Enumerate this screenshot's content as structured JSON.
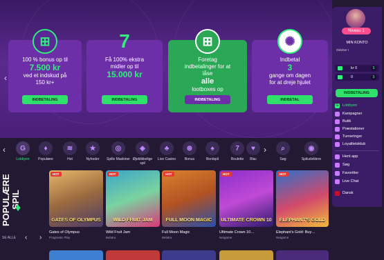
{
  "colors": {
    "accent": "#2ff07c",
    "purple": "#6d2fa8",
    "bg": "#241933"
  },
  "promos": [
    {
      "line1": "100 % bonus op til",
      "big": "7.500 kr",
      "line2": "ved et indskud på",
      "line3": "150 kr+",
      "button": "INDBETALING",
      "icon": "gift-icon"
    },
    {
      "line1": "Få 100% ekstra",
      "line2": "midler op til",
      "big": "15.000 kr",
      "button": "INDBETALING",
      "icon": "seven-icon"
    },
    {
      "line1": "Foretag",
      "line2": "indbetalinger for at",
      "line3": "låse",
      "big": "alle",
      "line4": "lootboxes op",
      "button": "INDBETALING",
      "icon": "gift-icon"
    },
    {
      "line1": "Indbetal",
      "big": "3",
      "line2": "gange om dagen",
      "line3": "for at dreje hjulet",
      "button": "INDBETAL",
      "icon": "wheel-icon"
    }
  ],
  "profile": {
    "level": "Niveau 1",
    "my_account": "MIN KONTO",
    "small": "Glitcher I",
    "balance1": "kr 0",
    "balance2": "0",
    "deposit_button": "INDBETALING"
  },
  "menu": [
    {
      "label": "Lobbyen",
      "icon": "lobby-icon"
    },
    {
      "label": "Kampagner",
      "icon": "megaphone-icon"
    },
    {
      "label": "Butik",
      "icon": "shop-icon"
    },
    {
      "label": "Præstationer",
      "icon": "trophy-icon"
    },
    {
      "label": "Turneringer",
      "icon": "tournament-icon"
    },
    {
      "label": "Loyalitetsklub",
      "icon": "loyalty-icon"
    },
    {
      "label": "Hent app",
      "icon": "download-icon"
    },
    {
      "label": "Søg",
      "icon": "search-icon"
    },
    {
      "label": "Favoritter",
      "icon": "heart-icon"
    },
    {
      "label": "Live Chat",
      "icon": "chat-icon"
    },
    {
      "label": "Dansk",
      "icon": "flag-icon"
    }
  ],
  "categories": [
    {
      "label": "Lobbyen",
      "glyph": "G"
    },
    {
      "label": "Populære",
      "glyph": "♦"
    },
    {
      "label": "Hot",
      "glyph": "≋"
    },
    {
      "label": "Nyheder",
      "glyph": "★"
    },
    {
      "label": "Spille Maskiner",
      "glyph": "◎"
    },
    {
      "label": "Øjeblikkelige spil",
      "glyph": "◈"
    },
    {
      "label": "Live Casino",
      "glyph": "♣"
    },
    {
      "label": "Bonus",
      "glyph": "⊛"
    },
    {
      "label": "Bordspil",
      "glyph": "♠"
    },
    {
      "label": "Roulette",
      "glyph": "7"
    },
    {
      "label": "Blac",
      "glyph": "♥"
    },
    {
      "label": "Søg",
      "glyph": "⌕"
    },
    {
      "label": "Spiludviklere",
      "glyph": "◉"
    }
  ],
  "row_title": "POPULÆRE SPIL",
  "see_all": "SE ALLE",
  "hot_badge": "HOT",
  "games": [
    {
      "name": "Gates of Olympus",
      "provider": "Pragmatic Play",
      "art": "GATES OF OLYMPUS"
    },
    {
      "name": "Wild Fruit Jam",
      "provider": "Belatra",
      "art": "WILD FRUIT JAM"
    },
    {
      "name": "Full Moon Magic",
      "provider": "Belatra",
      "art": "FULL MOON MAGIC"
    },
    {
      "name": "Ultimate Crown 10…",
      "provider": "Netgame",
      "art": "ULTIMATE CROWN 10"
    },
    {
      "name": "Elephant's Gold: Buy…",
      "provider": "Netgame",
      "art": "ELEPHANT'S GOLD"
    }
  ]
}
